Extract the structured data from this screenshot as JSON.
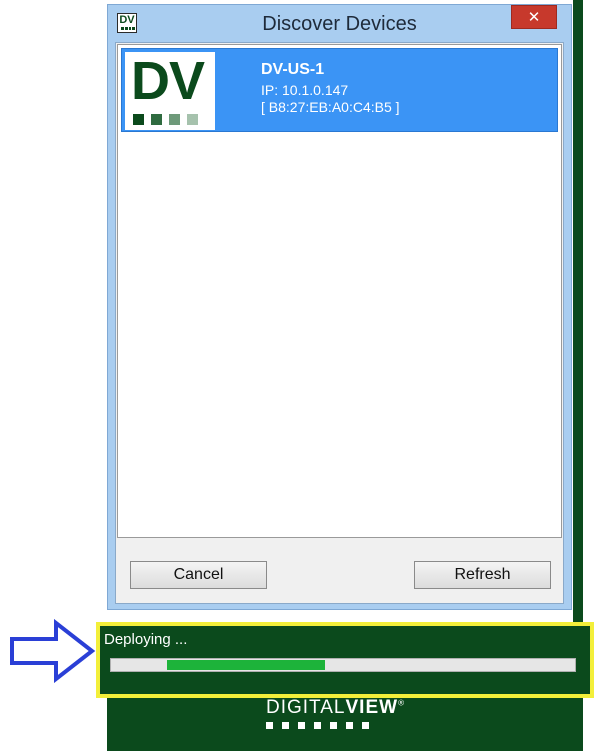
{
  "window": {
    "title": "Discover Devices",
    "icon_text": "DV",
    "close_symbol": "✕"
  },
  "devices": [
    {
      "logo_text": "DV",
      "name": "DV-US-1",
      "ip": "IP: 10.1.0.147",
      "mac": "[ B8:27:EB:A0:C4:B5 ]",
      "selected": true
    }
  ],
  "buttons": {
    "cancel": "Cancel",
    "refresh": "Refresh"
  },
  "status": {
    "text": "Deploying ...",
    "progress_fraction": 0.39
  },
  "brand": {
    "light": "DIGITAL",
    "bold": "VIEW",
    "mark": "®"
  },
  "colors": {
    "brand_green": "#0b4a1c",
    "selection_blue": "#3b94f5",
    "progress_green": "#1db33a",
    "highlight_yellow": "#f3ef3a",
    "annotation_arrow": "#2a3fd6"
  },
  "icons": [
    "dv-app-icon",
    "close-icon",
    "arrow-annotation-icon"
  ]
}
